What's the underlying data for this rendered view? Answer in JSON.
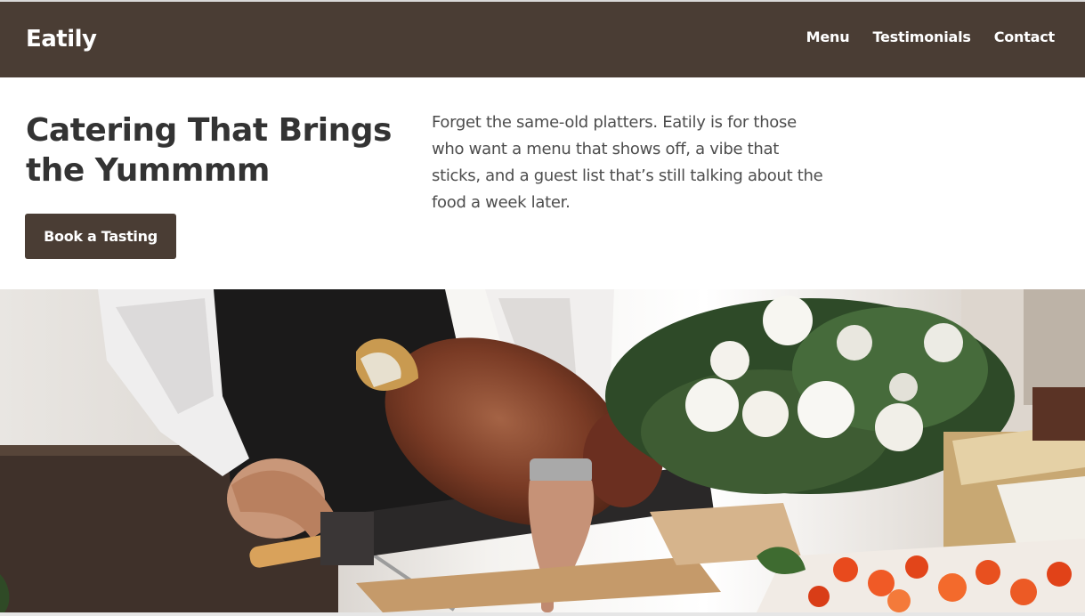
{
  "brand": {
    "name": "Eatily"
  },
  "nav": {
    "items": [
      {
        "label": "Menu"
      },
      {
        "label": "Testimonials"
      },
      {
        "label": "Contact"
      }
    ]
  },
  "hero": {
    "title": "Catering That Brings the Yummmm",
    "cta_label": "Book a Tasting",
    "description": "Forget the same-old platters. Eatily is for those who want a menu that shows off, a vibe that sticks, and a guest list that’s still talking about the food a week later."
  },
  "colors": {
    "header_bg": "#4a3d34",
    "button_bg": "#4a3d34",
    "heading_text": "#333333",
    "body_text": "#4d4d4d"
  }
}
